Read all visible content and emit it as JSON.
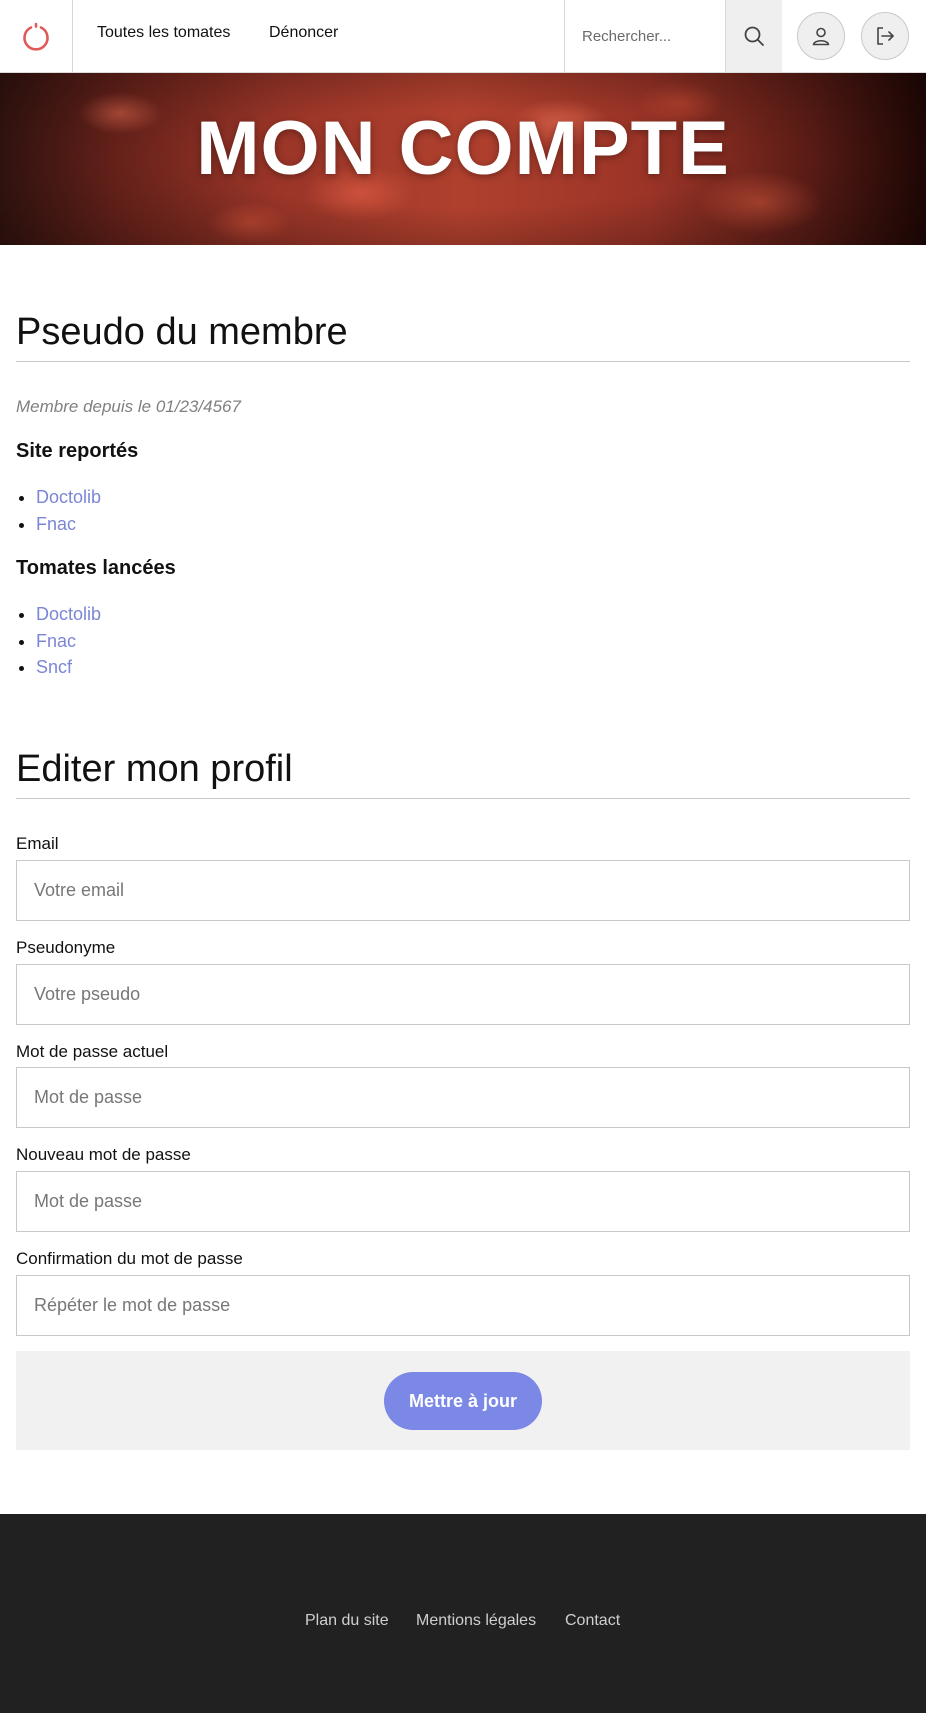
{
  "nav": {
    "links": [
      "Toutes les tomates",
      "Dénoncer"
    ],
    "search_placeholder": "Rechercher..."
  },
  "hero": {
    "title": "MON COMPTE"
  },
  "profile": {
    "title": "Pseudo du membre",
    "member_since": "Membre depuis le 01/23/4567",
    "reported_title": "Site reportés",
    "reported_sites": [
      "Doctolib",
      "Fnac"
    ],
    "tomatoes_title": "Tomates lancées",
    "tomatoes_sites": [
      "Doctolib",
      "Fnac",
      "Sncf"
    ]
  },
  "edit": {
    "title": "Editer mon profil",
    "fields": [
      {
        "label": "Email",
        "placeholder": "Votre email"
      },
      {
        "label": "Pseudonyme",
        "placeholder": "Votre pseudo"
      },
      {
        "label": "Mot de passe actuel",
        "placeholder": "Mot de passe"
      },
      {
        "label": "Nouveau mot de passe",
        "placeholder": "Mot de passe"
      },
      {
        "label": "Confirmation du mot de passe",
        "placeholder": "Répéter le mot de passe"
      }
    ],
    "submit_label": "Mettre à jour"
  },
  "footer": {
    "links": [
      "Plan du site",
      "Mentions légales",
      "Contact"
    ]
  },
  "colors": {
    "accent": "#7b88e6",
    "link": "#7b86d6",
    "logo": "#e05a5a",
    "footer_bg": "#212121"
  },
  "icons": {
    "logo": "power-icon",
    "search": "search-icon",
    "user": "user-icon",
    "logout": "logout-icon"
  }
}
